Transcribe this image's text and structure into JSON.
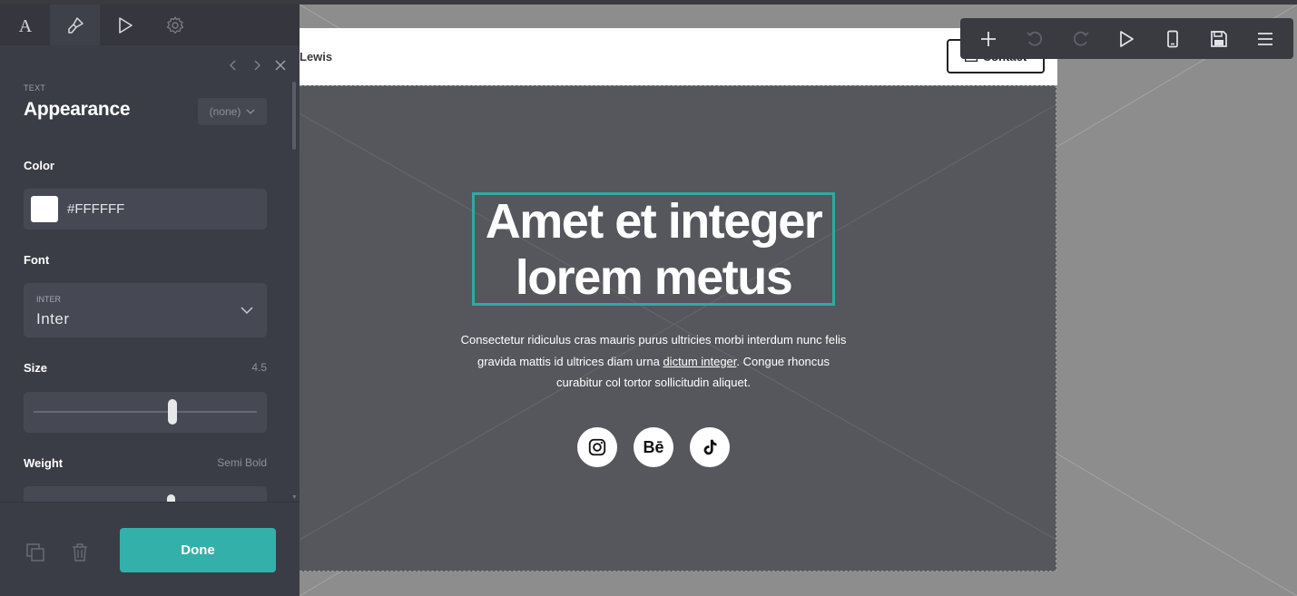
{
  "panel": {
    "tabs": [
      {
        "name": "text-tab",
        "icon": "text-icon"
      },
      {
        "name": "style-tab",
        "icon": "paintbrush-icon"
      },
      {
        "name": "animation-tab",
        "icon": "play-icon"
      },
      {
        "name": "settings-tab",
        "icon": "gear-icon"
      }
    ],
    "section_caption": "TEXT",
    "title": "Appearance",
    "preset": "(none)",
    "color_label": "Color",
    "color_value": "#FFFFFF",
    "font_label": "Font",
    "font_caption": "INTER",
    "font_value": "Inter",
    "size_label": "Size",
    "size_value": "4.5",
    "size_level": 0.62,
    "weight_label": "Weight",
    "weight_value": "Semi Bold",
    "done_label": "Done"
  },
  "site": {
    "name": "Lewis",
    "contact_label": "Contact",
    "headline": "Amet et integer lorem metus",
    "body_before": "Consectetur ridiculus cras mauris purus ultricies morbi interdum nunc felis gravida mattis id ultrices diam urna ",
    "body_link": "dictum integer",
    "body_after": ". Congue rhoncus curabitur col tortor sollicitudin aliquet.",
    "socials": [
      {
        "name": "instagram-icon",
        "glyph": ""
      },
      {
        "name": "behance-icon",
        "glyph": "Bē"
      },
      {
        "name": "tiktok-icon",
        "glyph": ""
      }
    ]
  },
  "toolbar": {
    "buttons": [
      "add-icon",
      "undo-icon",
      "redo-icon",
      "preview-icon",
      "mobile-icon",
      "save-icon",
      "menu-icon"
    ]
  },
  "colors": {
    "accent": "#34b0aa",
    "panel_bg": "#3b3d46",
    "hero_bg": "#56575c"
  }
}
